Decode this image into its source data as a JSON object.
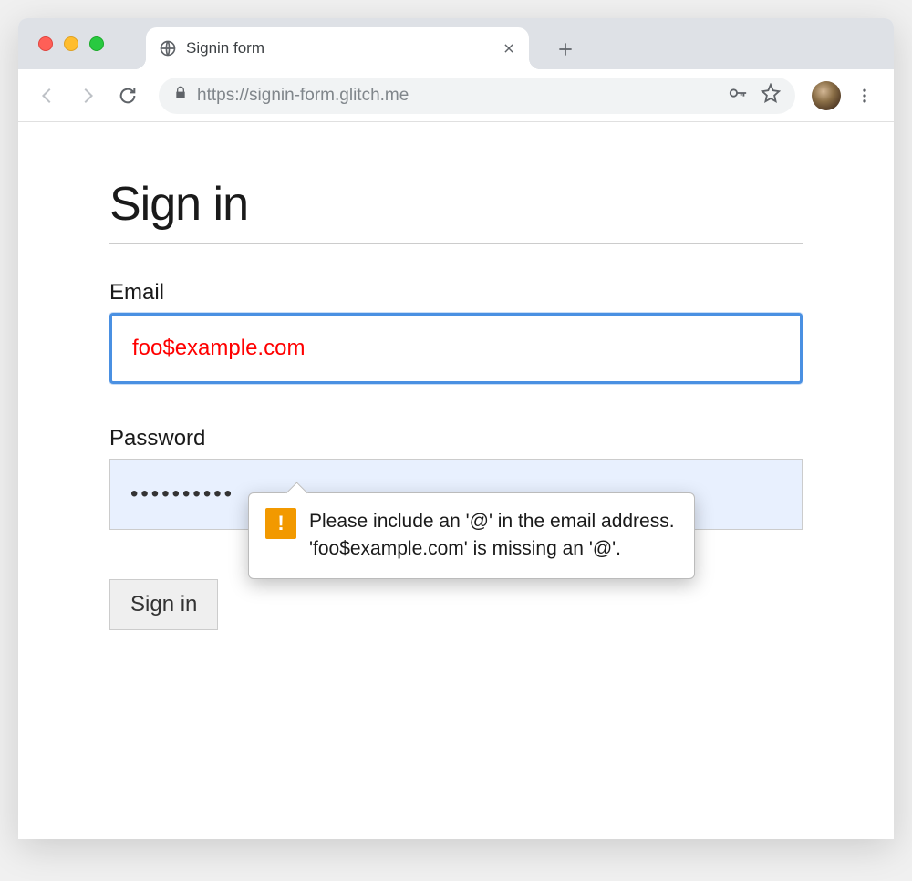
{
  "browser": {
    "tab_title": "Signin form",
    "url": "https://signin-form.glitch.me"
  },
  "page": {
    "heading": "Sign in",
    "email_label": "Email",
    "email_value": "foo$example.com",
    "password_label": "Password",
    "password_value": "••••••••••",
    "submit_label": "Sign in"
  },
  "validation": {
    "message": "Please include an '@' in the email address. 'foo$example.com' is missing an '@'."
  }
}
